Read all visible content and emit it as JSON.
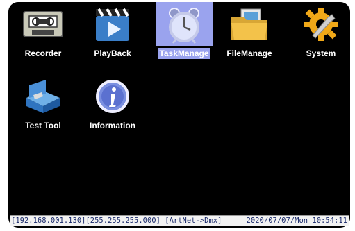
{
  "menu": {
    "selected": "TaskManage",
    "items": [
      {
        "label": "Recorder",
        "icon": "cassette-icon"
      },
      {
        "label": "PlayBack",
        "icon": "clapperboard-icon"
      },
      {
        "label": "TaskManage",
        "icon": "alarm-clock-icon"
      },
      {
        "label": "FileManage",
        "icon": "folder-icon"
      },
      {
        "label": "System",
        "icon": "gear-wrench-icon"
      },
      {
        "label": "Test Tool",
        "icon": "toolbox-icon"
      },
      {
        "label": "Information",
        "icon": "info-icon"
      }
    ]
  },
  "status": {
    "network": "[192.168.001.130][255.255.255.000] [ArtNet->Dmx]",
    "datetime": "2020/07/07/Mon 10:54:11"
  },
  "colors": {
    "background": "#000000",
    "selection": "#9aa3ee",
    "label": "#ffffff",
    "statusbar_bg": "#f2f2f2",
    "status_text": "#1a2a6a"
  }
}
